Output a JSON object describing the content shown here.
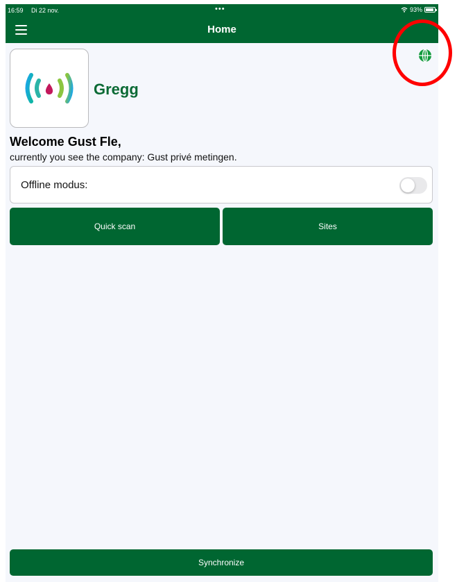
{
  "status_bar": {
    "time": "16:59",
    "date": "Di 22 nov.",
    "dots": "•••",
    "battery_text": "93%",
    "battery_level": 0.93
  },
  "nav": {
    "title": "Home",
    "menu_icon": "hamburger-menu-icon",
    "language_icon": "globe-icon"
  },
  "brand": {
    "name": "Gregg",
    "logo_icon": "signal-drop-logo"
  },
  "welcome": {
    "greeting": "Welcome Gust Fle,",
    "company_line": "currently you see the company: Gust privé metingen."
  },
  "offline": {
    "label": "Offline modus:",
    "enabled": false
  },
  "actions": {
    "quick_scan": "Quick scan",
    "sites": "Sites",
    "synchronize": "Synchronize"
  },
  "colors": {
    "primary": "#006631",
    "brand_text": "#0b6a35",
    "background": "#f5f7fc",
    "annotation": "#ff0000"
  }
}
